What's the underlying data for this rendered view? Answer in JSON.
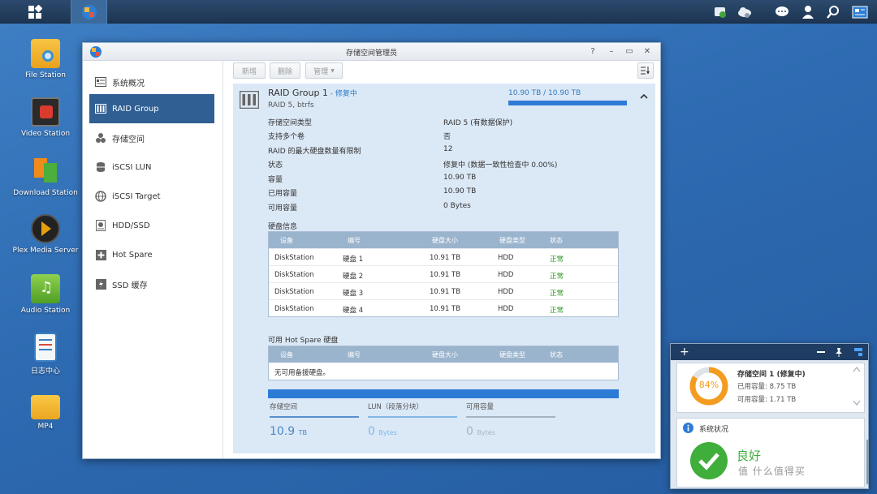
{
  "desktop": {
    "icons": [
      {
        "label": "File Station",
        "icon": "file-station-icon"
      },
      {
        "label": "Video Station",
        "icon": "video-station-icon"
      },
      {
        "label": "Download Station",
        "icon": "download-station-icon"
      },
      {
        "label": "Plex Media Server",
        "icon": "plex-icon"
      },
      {
        "label": "Audio Station",
        "icon": "audio-station-icon"
      },
      {
        "label": "日志中心",
        "icon": "log-center-icon"
      },
      {
        "label": "MP4",
        "icon": "folder-icon"
      }
    ]
  },
  "window": {
    "title": "存储空间管理员",
    "controls": [
      "?",
      "–",
      "▭",
      "✕"
    ]
  },
  "sidebar": {
    "items": [
      {
        "label": "系统概况",
        "icon": "overview-icon"
      },
      {
        "label": "RAID Group",
        "icon": "raid-group-icon"
      },
      {
        "label": "存储空间",
        "icon": "volume-icon"
      },
      {
        "label": "iSCSI LUN",
        "icon": "iscsi-lun-icon"
      },
      {
        "label": "iSCSI Target",
        "icon": "iscsi-target-icon"
      },
      {
        "label": "HDD/SSD",
        "icon": "hdd-icon"
      },
      {
        "label": "Hot Spare",
        "icon": "hot-spare-icon"
      },
      {
        "label": "SSD 缓存",
        "icon": "ssd-cache-icon"
      }
    ]
  },
  "toolbar": {
    "create": "新增",
    "delete": "删除",
    "manage": "管理"
  },
  "raid": {
    "name": "RAID Group 1",
    "status": " - 修复中",
    "subtitle": "RAID 5, btrfs",
    "usage_text": "10.90 TB / 10.90 TB",
    "usage_fraction": 1.0,
    "props": [
      {
        "label": "存储空间类型",
        "value": "RAID 5 (有数据保护)"
      },
      {
        "label": "支持多个卷",
        "value": "否"
      },
      {
        "label": "RAID 的最大硬盘数量有限制",
        "value": "12"
      },
      {
        "label": "状态",
        "value": "修复中 (数据一致性检查中 0.00%)"
      },
      {
        "label": "容量",
        "value": "10.90 TB"
      },
      {
        "label": "已用容量",
        "value": "10.90 TB"
      },
      {
        "label": "可用容量",
        "value": "0 Bytes"
      }
    ]
  },
  "disk_info": {
    "title": "硬盘信息",
    "headers": [
      "设备",
      "编号",
      "硬盘大小",
      "硬盘类型",
      "状态"
    ],
    "rows": [
      [
        "DiskStation",
        "硬盘 1",
        "10.91 TB",
        "HDD",
        "正常"
      ],
      [
        "DiskStation",
        "硬盘 2",
        "10.91 TB",
        "HDD",
        "正常"
      ],
      [
        "DiskStation",
        "硬盘 3",
        "10.91 TB",
        "HDD",
        "正常"
      ],
      [
        "DiskStation",
        "硬盘 4",
        "10.91 TB",
        "HDD",
        "正常"
      ]
    ]
  },
  "hot_spare": {
    "title": "可用 Hot Spare 硬盘",
    "headers": [
      "设备",
      "编号",
      "硬盘大小",
      "硬盘类型",
      "状态"
    ],
    "empty": "无可用备援硬盘。"
  },
  "summary": [
    {
      "label": "存储空间",
      "value": "10.9",
      "unit": "TB",
      "color": "#5a8fd0"
    },
    {
      "label": "LUN（段落分块）",
      "value": "0",
      "unit": "Bytes",
      "color": "#82b8e6"
    },
    {
      "label": "可用容量",
      "value": "0",
      "unit": "Bytes",
      "color": "#a8b3bf"
    }
  ],
  "widget": {
    "volume_title": "存储空间 1 (修复中)",
    "used": "已用容量: 8.75 TB",
    "free": "可用容量: 1.71 TB",
    "percent": "84%",
    "percent_value": 84,
    "system_status_title": "系统状况",
    "system_status": "良好",
    "watermark": "值 什么值得买"
  },
  "colors": {
    "accent": "#2f5f93",
    "ok": "#2f9a26",
    "ring": "#f39c1f"
  }
}
